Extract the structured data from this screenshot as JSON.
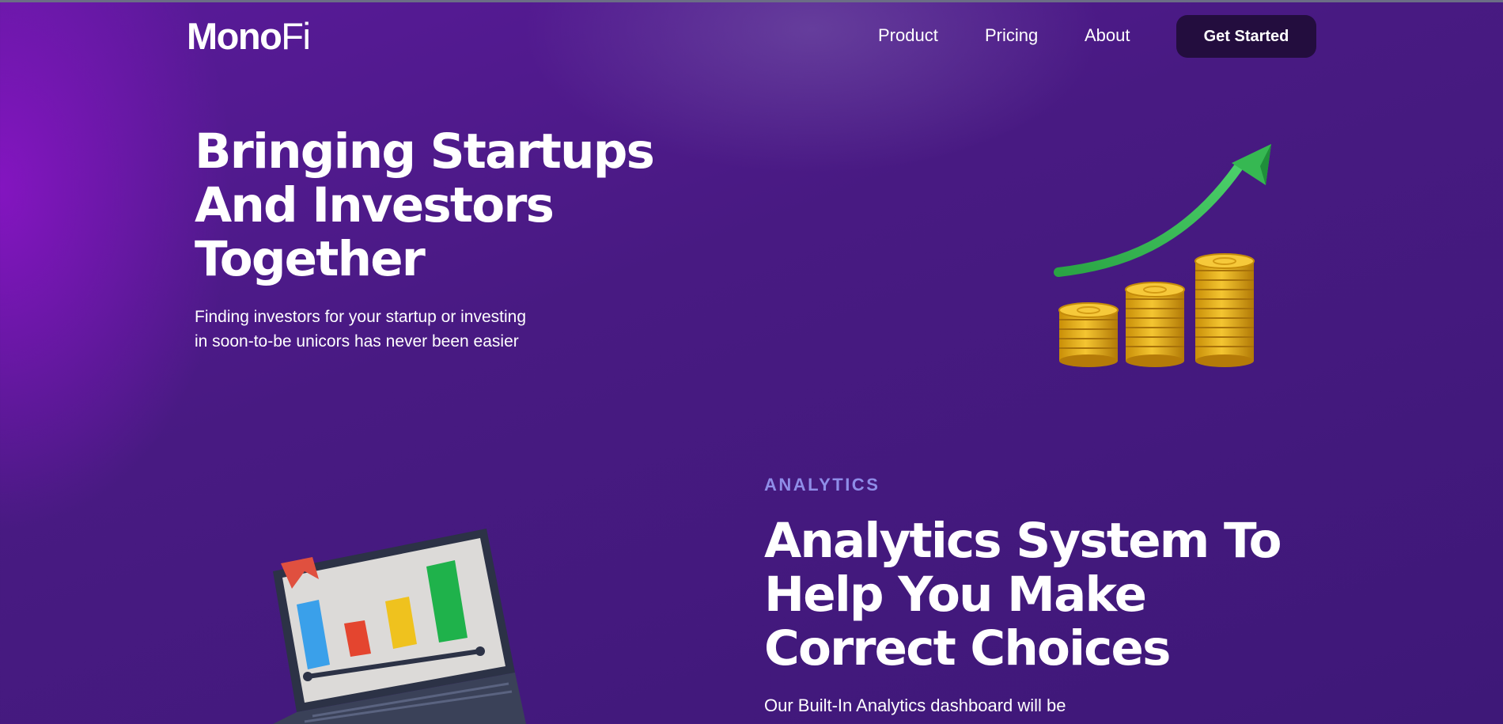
{
  "header": {
    "logo_bold": "Mono",
    "logo_light": "Fi",
    "nav": {
      "product": "Product",
      "pricing": "Pricing",
      "about": "About"
    },
    "cta_label": "Get Started"
  },
  "hero": {
    "title_line1": "Bringing Startups",
    "title_line2": "And Investors",
    "title_line3": "Together",
    "subtitle": "Finding investors for your startup or investing in soon-to-be unicors has never been easier",
    "illustration": "growth-coins-arrow-icon"
  },
  "analytics": {
    "eyebrow": "ANALYTICS",
    "title_line1": "Analytics System To",
    "title_line2": "Help You Make",
    "title_line3": "Correct Choices",
    "subtitle": "Our Built-In Analytics dashboard will be",
    "illustration": "laptop-bar-chart-icon"
  },
  "colors": {
    "background": "#481a82",
    "cta_background": "#230d3e",
    "eyebrow": "#8f8de8",
    "arrow": "#2fae4a",
    "coin": "#e8b420"
  }
}
